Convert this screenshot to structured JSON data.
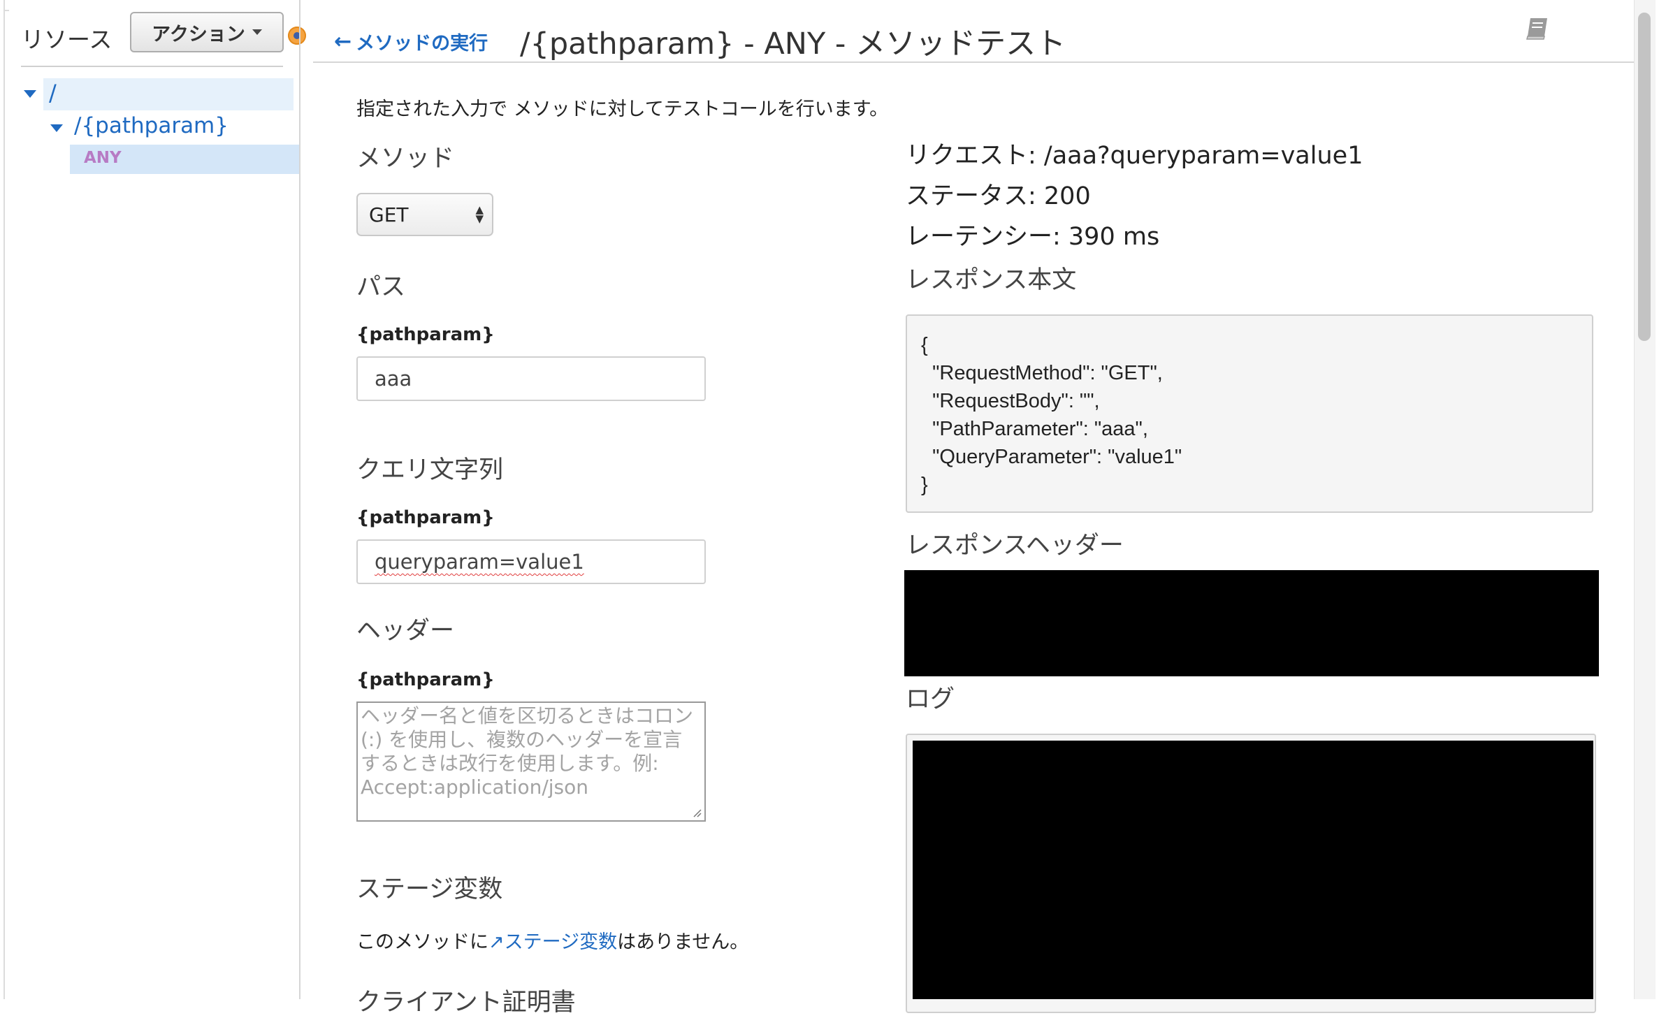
{
  "sidebar": {
    "title": "リソース",
    "actions_label": "アクション",
    "tree": {
      "root": "/",
      "child": "/{pathparam}",
      "method": "ANY"
    }
  },
  "header": {
    "back_label": "メソッドの実行",
    "title": "/{pathparam} - ANY - メソッドテスト"
  },
  "form": {
    "intro": "指定された入力で メソッドに対してテストコールを行います。",
    "method_heading": "メソッド",
    "method_value": "GET",
    "path_heading": "パス",
    "path_param_label": "{pathparam}",
    "path_value": "aaa",
    "query_heading": "クエリ文字列",
    "query_param_label": "{pathparam}",
    "query_value": "queryparam=value1",
    "headers_heading": "ヘッダー",
    "headers_param_label": "{pathparam}",
    "headers_placeholder": "ヘッダー名と値を区切るときはコロン (:) を使用し、複数のヘッダーを宣言するときは改行を使用します。例: Accept:application/json",
    "stage_vars_heading": "ステージ変数",
    "stage_vars_prefix": "このメソッドに",
    "stage_vars_link": "ステージ変数",
    "stage_vars_suffix": "はありません。",
    "client_cert_heading": "クライアント証明書"
  },
  "result": {
    "request": "リクエスト: /aaa?queryparam=value1",
    "status": "ステータス: 200",
    "latency": "レーテンシー: 390 ms",
    "body_heading": "レスポンス本文",
    "body": "{\n  \"RequestMethod\": \"GET\",\n  \"RequestBody\": \"\",\n  \"PathParameter\": \"aaa\",\n  \"QueryParameter\": \"value1\"\n}",
    "headers_heading": "レスポンスヘッダー",
    "logs_heading": "ログ"
  },
  "icons": {
    "book": "book-icon",
    "back": "arrow-left-icon",
    "external": "external-link-icon"
  },
  "colors": {
    "link": "#1f6ac1",
    "tree_selected": "#d4e6f8",
    "method_badge": "#b77bc4",
    "splitter": "#f5a340"
  }
}
